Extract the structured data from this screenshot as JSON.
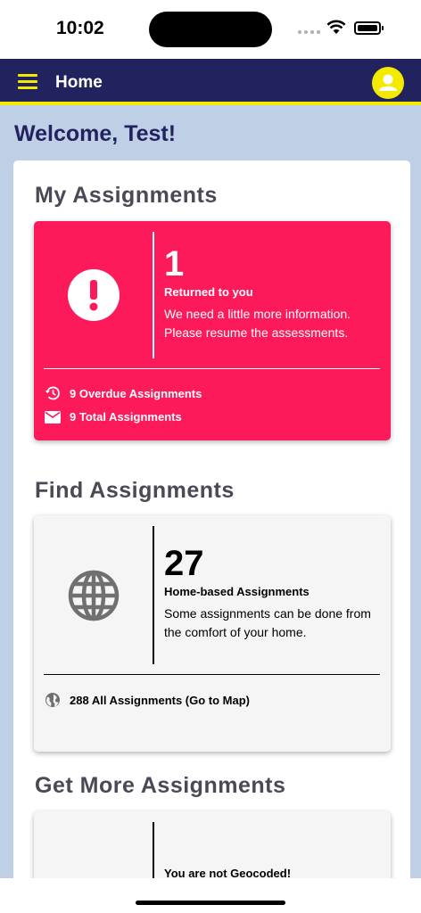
{
  "status": {
    "time": "10:02"
  },
  "app_bar": {
    "title": "Home"
  },
  "welcome": "Welcome, Test!",
  "my_assignments": {
    "title": "My Assignments",
    "count": "1",
    "subtitle": "Returned to you",
    "description": "We need a little more information. Please resume the assessments.",
    "overdue": "9 Overdue Assignments",
    "total": "9 Total Assignments"
  },
  "find_assignments": {
    "title": "Find Assignments",
    "count": "27",
    "subtitle": "Home-based Assignments",
    "description": "Some assignments can be done from the comfort of your home.",
    "all_link": "288 All Assignments (Go to Map)"
  },
  "get_more": {
    "title": "Get More Assignments",
    "subtitle": "You are not Geocoded!"
  },
  "colors": {
    "navy": "#22225f",
    "yellow": "#f4ea00",
    "pink": "#fc1a5b",
    "background": "#bfd0e6"
  }
}
